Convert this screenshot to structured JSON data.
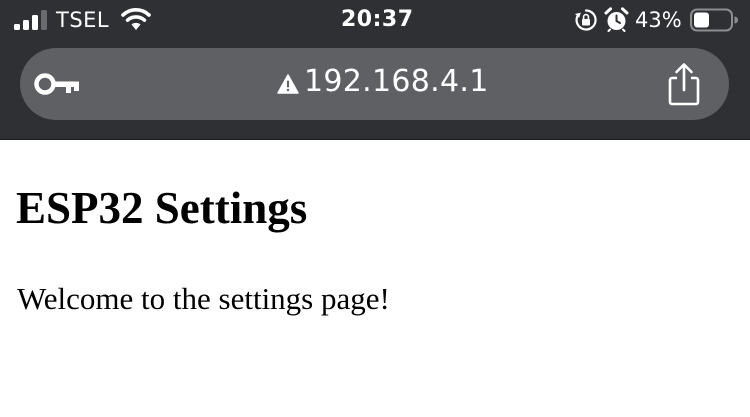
{
  "status_bar": {
    "carrier": "TSEL",
    "time": "20:37",
    "battery_percent": "43%",
    "battery_level": 0.43,
    "signal_bars": 3,
    "icons": [
      "signal-icon",
      "wifi-icon",
      "lock-rotation-icon",
      "alarm-icon",
      "battery-icon"
    ]
  },
  "address_bar": {
    "url": "192.168.4.1",
    "security": "not-secure",
    "icons": [
      "key-icon",
      "warning-icon",
      "share-icon"
    ]
  },
  "page": {
    "title": "ESP32 Settings",
    "welcome": "Welcome to the settings page!"
  },
  "colors": {
    "chrome_background": "#2f3033",
    "url_bar_background": "#5e6064",
    "page_background": "#ffffff",
    "text": "#000000"
  }
}
